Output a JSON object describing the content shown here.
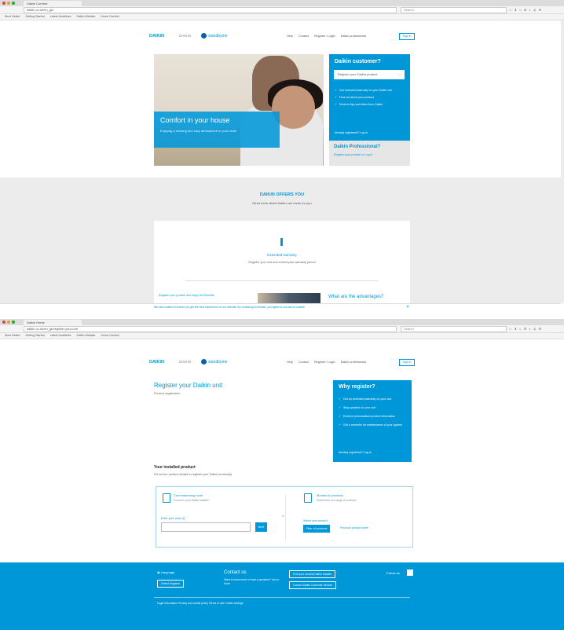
{
  "browser1": {
    "tab": "Daikin Comfort",
    "url": "daikin.co.uk/en_gb/",
    "search": "Search",
    "bookmarks": [
      "Most Visited",
      "Getting Started",
      "Latest Headlines",
      "Daikin Website",
      "Home Comfort"
    ]
  },
  "browser2": {
    "tab": "Daikin Home",
    "url": "daikin.co.uk/en_gb/register-your-unit",
    "search": "Search",
    "bookmarks": [
      "Most Visited",
      "Getting Started",
      "Latest Headlines",
      "Daikin Website",
      "Home Comfort"
    ]
  },
  "header": {
    "logo": "DAIKIN",
    "sub_logo": "DAIKIN",
    "brand": "standbyme",
    "nav": [
      "Help",
      "Contact",
      "Register / Login",
      "Daikin professional"
    ],
    "signin": "Sign in"
  },
  "hero": {
    "title": "Comfort in your house",
    "subtitle": "Enjoying a relaxing and cozy atmosphere in your home"
  },
  "customer_panel": {
    "title": "Daikin customer?",
    "select": "Register your Daikin product",
    "benefits": [
      "Get extended warranty on your Daikin unit",
      "Find out about your product",
      "Receive tips and tricks from Daikin"
    ],
    "link": "Already registered? Log in",
    "pro_title": "Daikin Professional?",
    "pro_link": "Register your product or Log in"
  },
  "offers": {
    "title": "DAIKIN OFFERS YOU",
    "subtitle": "Read more about Daikin can mean for you",
    "card_title": "Extended warranty",
    "card_sub": "Register your unit and extend your warranty period",
    "foot_link": "Register your product and enjoy the benefits",
    "advantages": "What are the advantages?"
  },
  "cookie": {
    "text": "We use cookies to ensure you get the best experience on our website. By continuing to browse, you agree to our use of cookies.",
    "close": "✕"
  },
  "register": {
    "title": "Register your Daikin unit",
    "subtitle": "Product registration",
    "why_title": "Why register?",
    "why_items": [
      "Get an extended warranty on your unit",
      "Stay updated on your unit",
      "Receive personalised product information",
      "Get a reminder for maintenance of your system"
    ],
    "why_link": "Already registered? Log in",
    "product_title": "Your installed product",
    "product_sub": "Fill out the product details to register your Daikin product(s)",
    "left_title": "Commissioning code",
    "left_sub": "Found on your Daikin installer",
    "left_label": "Enter your code (s)",
    "left_button": "Next",
    "or": "or",
    "right_title": "Models of products",
    "right_sub": "Select from our range of products",
    "right_label": "Select your product",
    "right_button": "Filter of products",
    "right_link": "Find your product name"
  },
  "footer": {
    "language": "Language",
    "language_btn": "United Kingdom",
    "contact_title": "Contact us",
    "contact_text": "Want to know more or have a question? Let us know",
    "btn1": "Find your nearest Daikin installer",
    "btn2": "Contact Daikin Customer Service",
    "follow": "Follow us",
    "links": "Legal information   Privacy and cookie policy   Terms of use   Cookie settings"
  }
}
